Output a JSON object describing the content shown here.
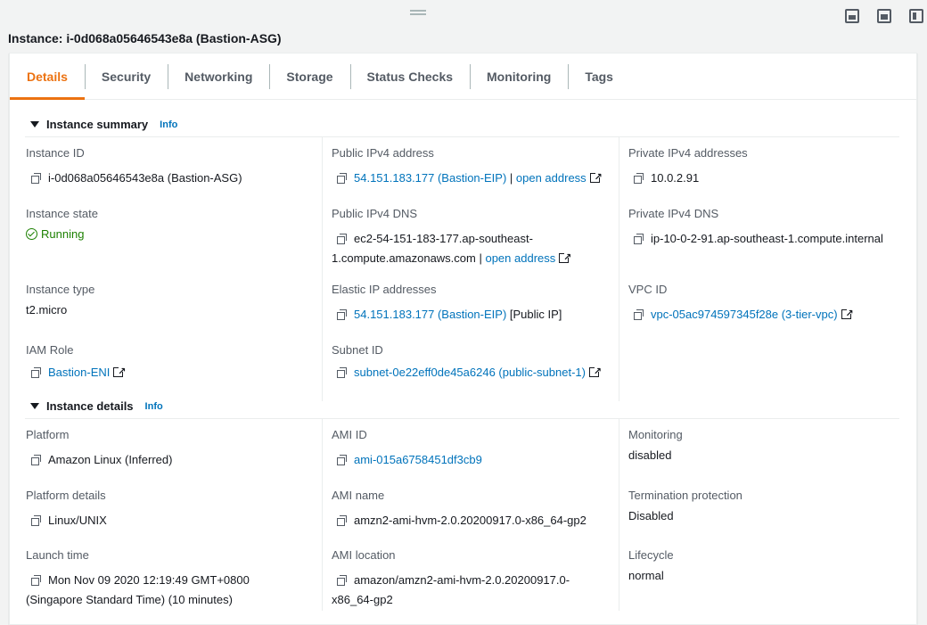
{
  "window": {
    "minimize_icon": "panel-bottom-icon",
    "restore_icon": "panel-split-icon",
    "maximize_icon": "panel-side-icon"
  },
  "title": "Instance: i-0d068a05646543e8a (Bastion-ASG)",
  "tabs": [
    "Details",
    "Security",
    "Networking",
    "Storage",
    "Status Checks",
    "Monitoring",
    "Tags"
  ],
  "active_tab": "Details",
  "summary": {
    "header": "Instance summary",
    "info": "Info",
    "instance_id_label": "Instance ID",
    "instance_id": "i-0d068a05646543e8a (Bastion-ASG)",
    "public_ipv4_label": "Public IPv4 address",
    "public_ipv4": "54.151.183.177 (Bastion-EIP)",
    "sep": " | ",
    "open_address": "open address",
    "private_ipv4_label": "Private IPv4 addresses",
    "private_ipv4": "10.0.2.91",
    "state_label": "Instance state",
    "state": "Running",
    "public_dns_label": "Public IPv4 DNS",
    "public_dns_line1": "ec2-54-151-183-177.ap-southeast-",
    "public_dns_line2": "1.compute.amazonaws.com",
    "private_dns_label": "Private IPv4 DNS",
    "private_dns": "ip-10-0-2-91.ap-southeast-1.compute.internal",
    "type_label": "Instance type",
    "type": "t2.micro",
    "eip_label": "Elastic IP addresses",
    "eip": "54.151.183.177 (Bastion-EIP)",
    "eip_suffix": " [Public IP]",
    "vpc_label": "VPC ID",
    "vpc": "vpc-05ac974597345f28e (3-tier-vpc)",
    "iam_label": "IAM Role",
    "iam": "Bastion-ENI",
    "subnet_label": "Subnet ID",
    "subnet": "subnet-0e22eff0de45a6246 (public-subnet-1)"
  },
  "details": {
    "header": "Instance details",
    "info": "Info",
    "platform_label": "Platform",
    "platform": "Amazon Linux (Inferred)",
    "ami_id_label": "AMI ID",
    "ami_id": "ami-015a6758451df3cb9",
    "monitoring_label": "Monitoring",
    "monitoring": "disabled",
    "platform_details_label": "Platform details",
    "platform_details": "Linux/UNIX",
    "ami_name_label": "AMI name",
    "ami_name": "amzn2-ami-hvm-2.0.20200917.0-x86_64-gp2",
    "termination_label": "Termination protection",
    "termination": "Disabled",
    "launch_label": "Launch time",
    "launch_line1": "Mon Nov 09 2020 12:19:49 GMT+0800",
    "launch_line2": "(Singapore Standard Time) (10 minutes)",
    "ami_location_label": "AMI location",
    "ami_location_line1": "amazon/amzn2-ami-hvm-2.0.20200917.0-",
    "ami_location_line2": "x86_64-gp2",
    "lifecycle_label": "Lifecycle",
    "lifecycle": "normal"
  }
}
